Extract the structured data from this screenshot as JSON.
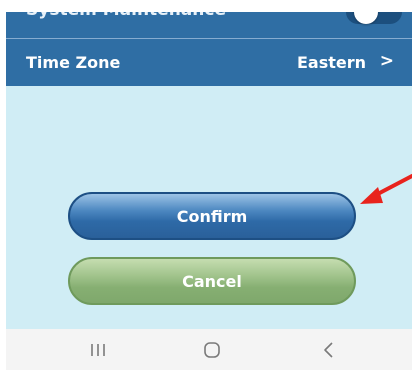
{
  "settings": {
    "partial_row_label": "System Maintenance",
    "partial_row_toggle_on": false,
    "time_zone": {
      "label": "Time Zone",
      "value": "Eastern",
      "chevron": ">"
    }
  },
  "actions": {
    "confirm_label": "Confirm",
    "cancel_label": "Cancel"
  },
  "annotation": {
    "arrow_color": "#e8231d",
    "points_to": "confirm-button"
  },
  "colors": {
    "panel_blue": "#2f6ea4",
    "content_bg": "#d0edf5",
    "confirm_blue": "#2e6aa7",
    "cancel_green": "#86af72"
  },
  "navbar": {
    "items": [
      {
        "icon": "recent-apps-icon"
      },
      {
        "icon": "home-icon"
      },
      {
        "icon": "back-icon"
      }
    ]
  }
}
